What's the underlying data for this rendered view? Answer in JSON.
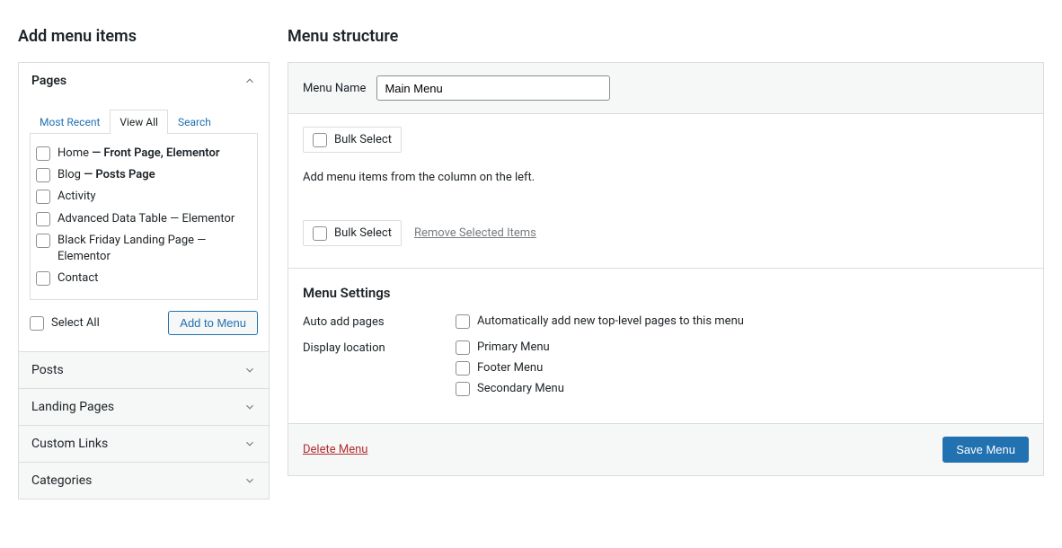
{
  "left": {
    "heading": "Add menu items",
    "sections": {
      "pages_title": "Pages",
      "posts_title": "Posts",
      "landing_title": "Landing Pages",
      "custom_links_title": "Custom Links",
      "categories_title": "Categories"
    },
    "tabs": {
      "most_recent": "Most Recent",
      "view_all": "View All",
      "search": "Search"
    },
    "pages": [
      {
        "label": "Home",
        "suffix": " — Front Page, Elementor"
      },
      {
        "label": "Blog",
        "suffix": " — Posts Page"
      },
      {
        "label": "Activity",
        "suffix": ""
      },
      {
        "label": "Advanced Data Table — Elementor",
        "suffix": ""
      },
      {
        "label": "Black Friday Landing Page — Elementor",
        "suffix": ""
      },
      {
        "label": "Contact",
        "suffix": ""
      }
    ],
    "select_all": "Select All",
    "add_to_menu": "Add to Menu"
  },
  "right": {
    "heading": "Menu structure",
    "menu_name_label": "Menu Name",
    "menu_name_value": "Main Menu",
    "bulk_select": "Bulk Select",
    "hint": "Add menu items from the column on the left.",
    "remove_selected": "Remove Selected Items",
    "settings_heading": "Menu Settings",
    "auto_add_label": "Auto add pages",
    "auto_add_option": "Automatically add new top-level pages to this menu",
    "display_location_label": "Display location",
    "locations": {
      "primary": "Primary Menu",
      "footer": "Footer Menu",
      "secondary": "Secondary Menu"
    },
    "delete_menu": "Delete Menu",
    "save_menu": "Save Menu"
  }
}
